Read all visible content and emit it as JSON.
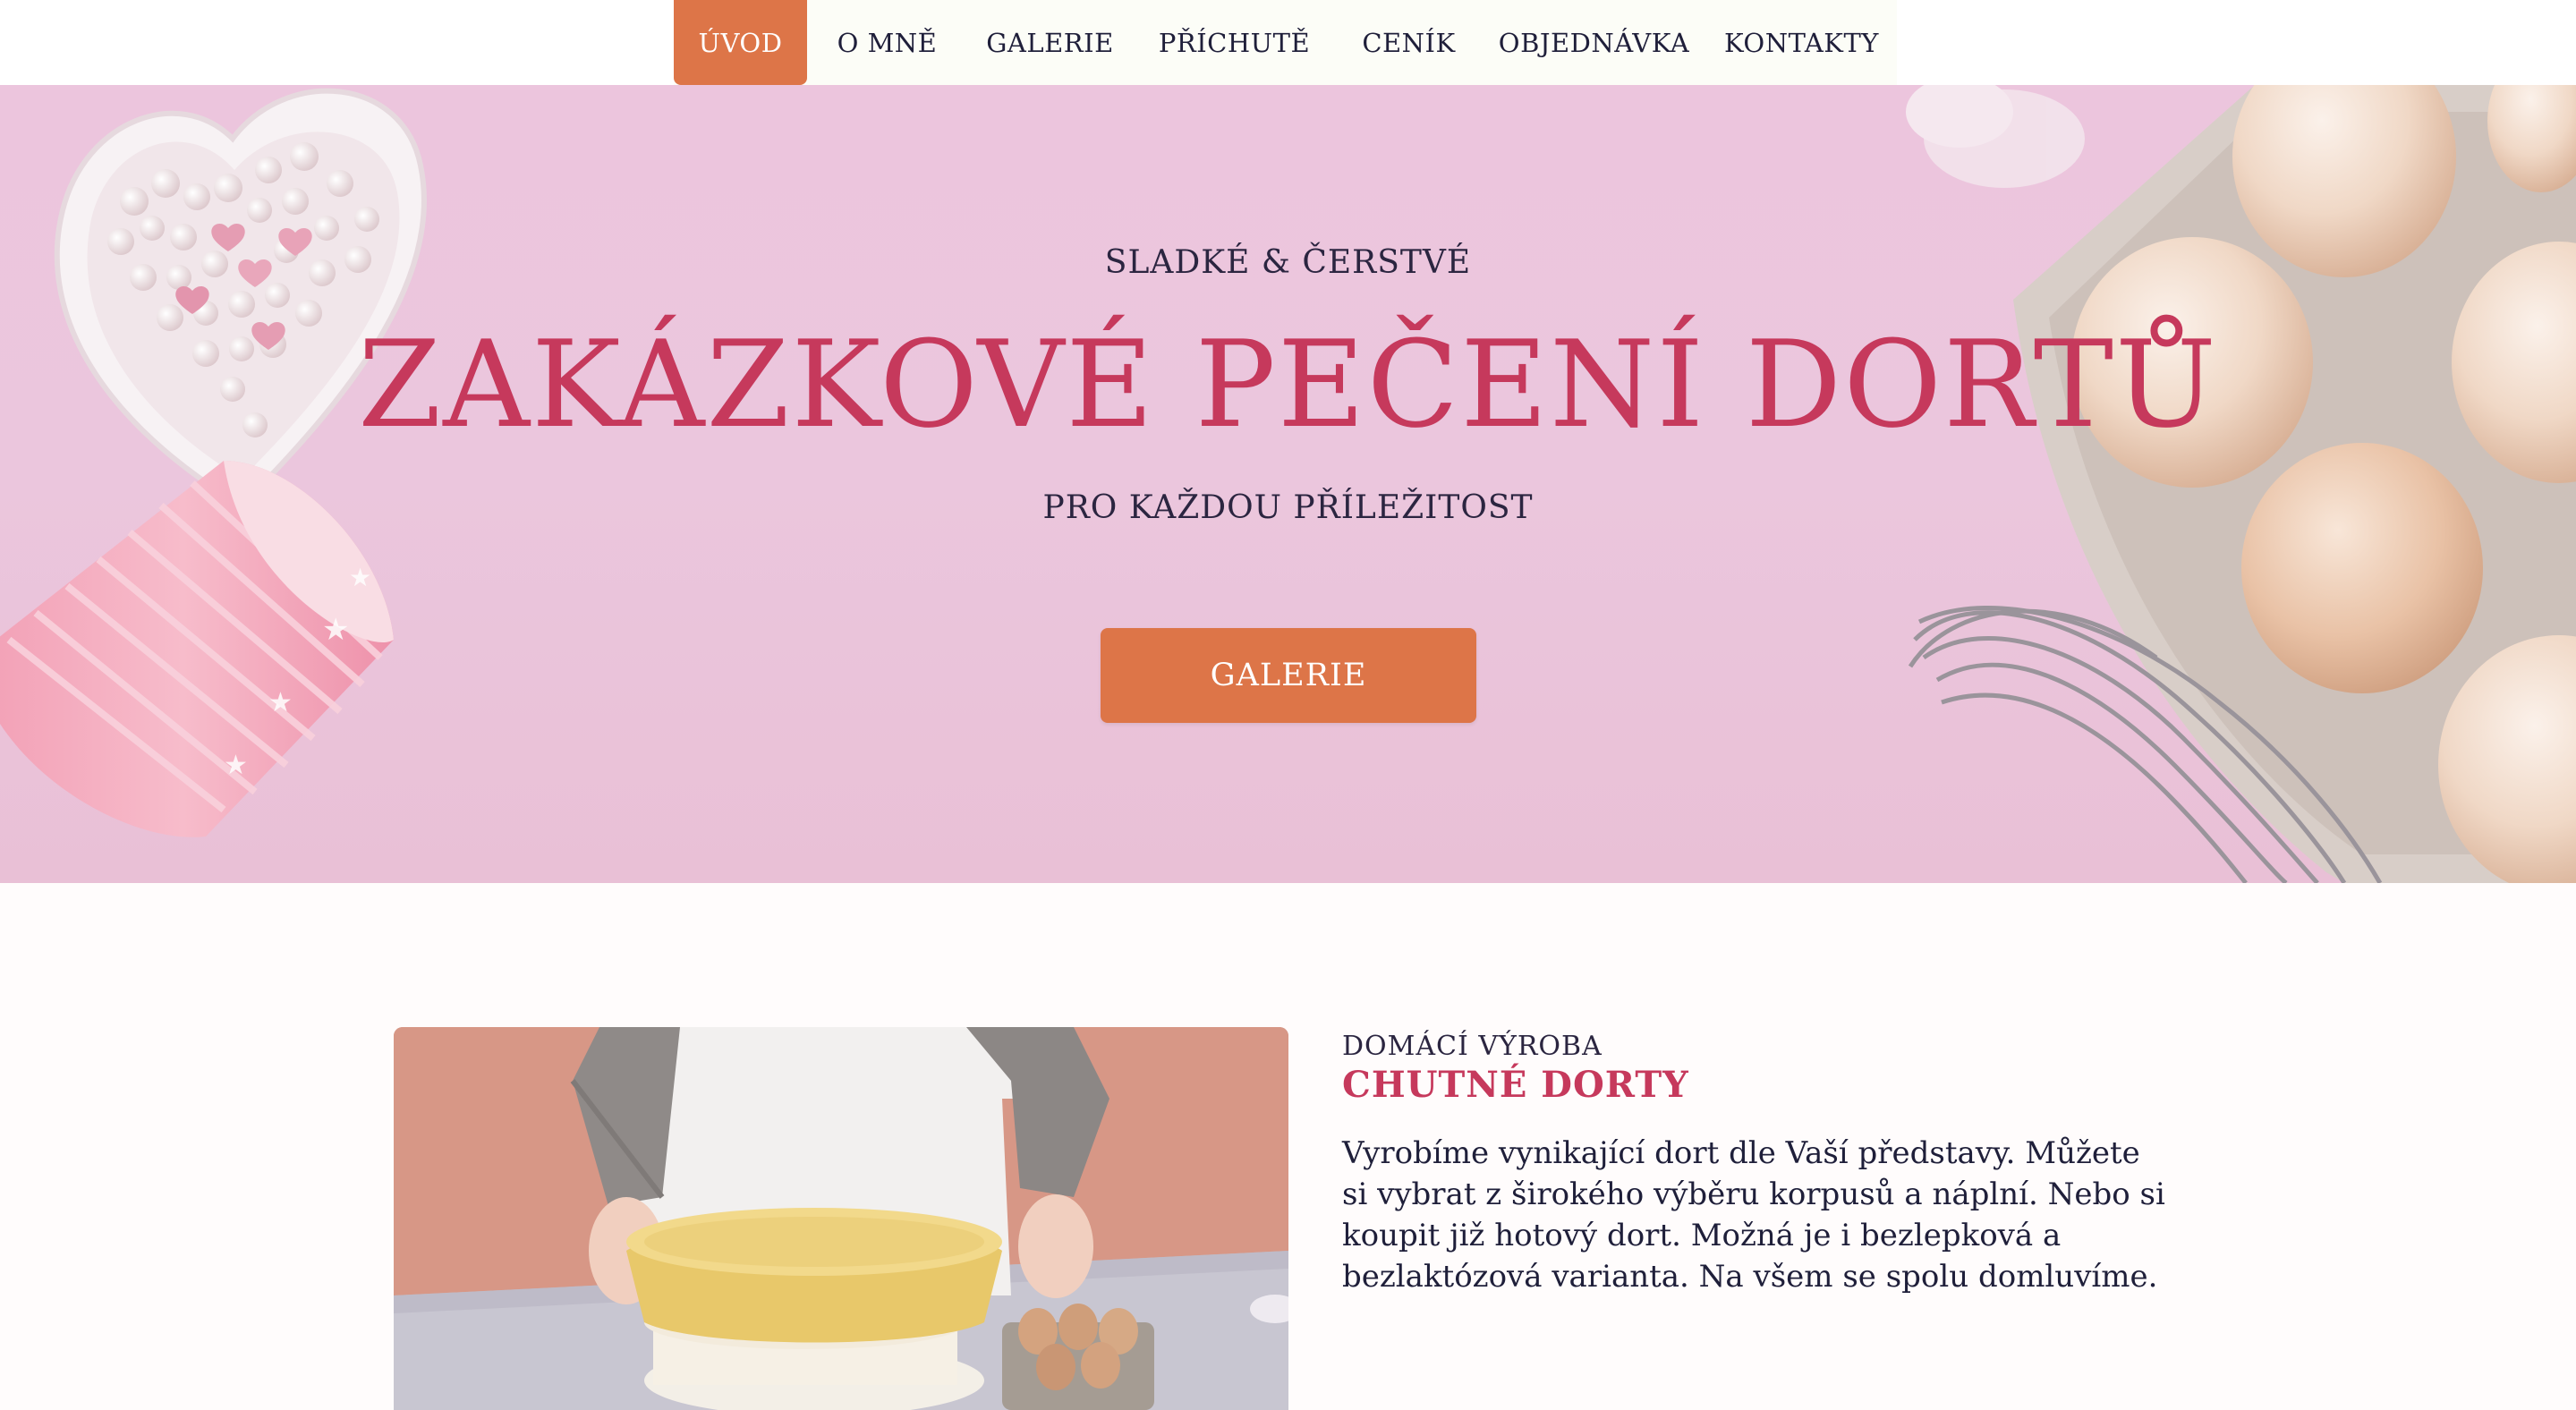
{
  "nav": {
    "items": [
      {
        "label": "ÚVOD",
        "active": true
      },
      {
        "label": "O MNĚ"
      },
      {
        "label": "GALERIE"
      },
      {
        "label": "PŘÍCHUTĚ"
      },
      {
        "label": "CENÍK"
      },
      {
        "label": "OBJEDNÁVKA"
      },
      {
        "label": "KONTAKTY"
      }
    ]
  },
  "hero": {
    "subtitle": "SLADKÉ & ČERSTVÉ",
    "title": "ZAKÁZKOVÉ PEČENÍ DORTŮ",
    "tagline": "PRO KAŽDOU PŘÍLEŽITOST",
    "button_label": "GALERIE"
  },
  "about": {
    "kicker": "DOMÁCÍ VÝROBA",
    "title": "CHUTNÉ DORTY",
    "body": "Vyrobíme vynikající dort dle Vaší představy. Můžete si vybrat z širokého výběru korpusů a náplní. Nebo si koupit již hotový dort. Možná je i bezlepková a bezlaktózová varianta. Na všem se spolu domluvíme."
  },
  "colors": {
    "accent": "#dd7548",
    "title": "#c6395c",
    "hero_bg": "#ecc5dd",
    "text": "#1f1f3a"
  }
}
